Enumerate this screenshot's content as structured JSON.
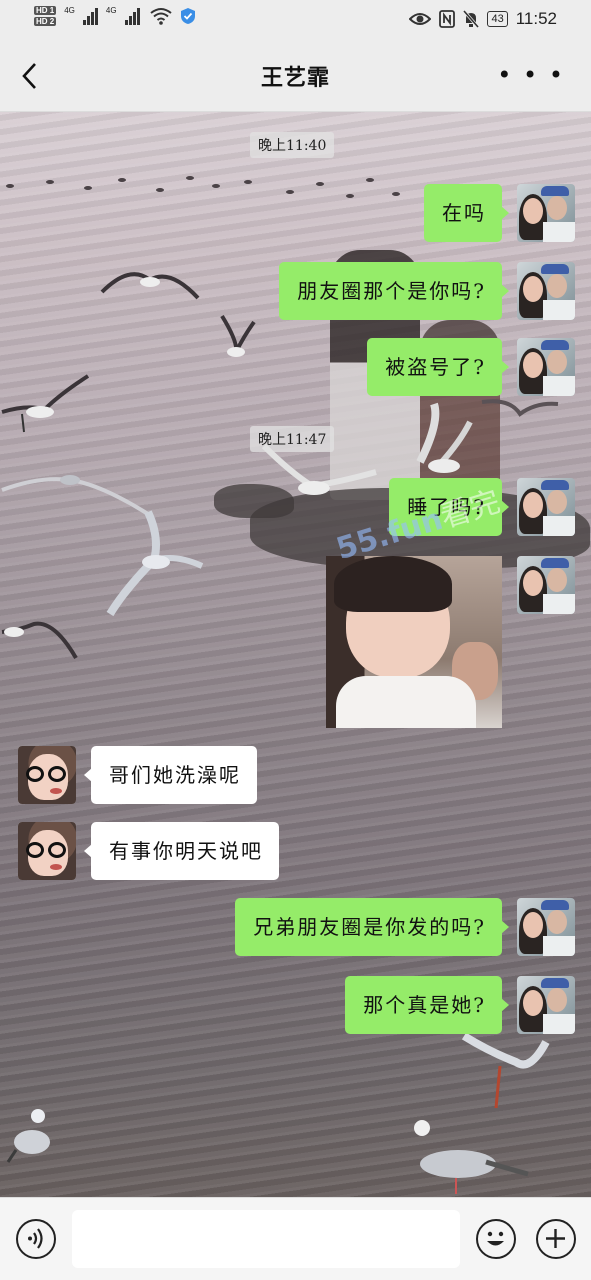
{
  "status_bar": {
    "hd1": "HD 1",
    "hd2": "HD 2",
    "net1": "4G",
    "net2": "4G",
    "battery": "43",
    "time": "11:52"
  },
  "nav": {
    "title": "王艺霏"
  },
  "timestamps": [
    "晚上11:40",
    "晚上11:47"
  ],
  "messages": [
    {
      "from": "self",
      "text": "在吗"
    },
    {
      "from": "self",
      "text": "朋友圈那个是你吗?"
    },
    {
      "from": "self",
      "text": "被盗号了?"
    },
    {
      "from": "self",
      "text": "睡了吗?"
    },
    {
      "from": "self",
      "type": "image"
    },
    {
      "from": "other",
      "text": "哥们她洗澡呢"
    },
    {
      "from": "other",
      "text": "有事你明天说吧"
    },
    {
      "from": "self",
      "text": "兄弟朋友圈是你发的吗?"
    },
    {
      "from": "self",
      "text": "那个真是她?"
    }
  ],
  "watermark": {
    "site": "55.fun",
    "text": "看完"
  },
  "input_bar": {
    "voice_icon": "voice-icon",
    "emoji_icon": "emoji-icon",
    "plus_icon": "plus-icon"
  },
  "colors": {
    "self_bubble": "#95ec69",
    "other_bubble": "#ffffff",
    "nav_bg": "#ededed"
  }
}
